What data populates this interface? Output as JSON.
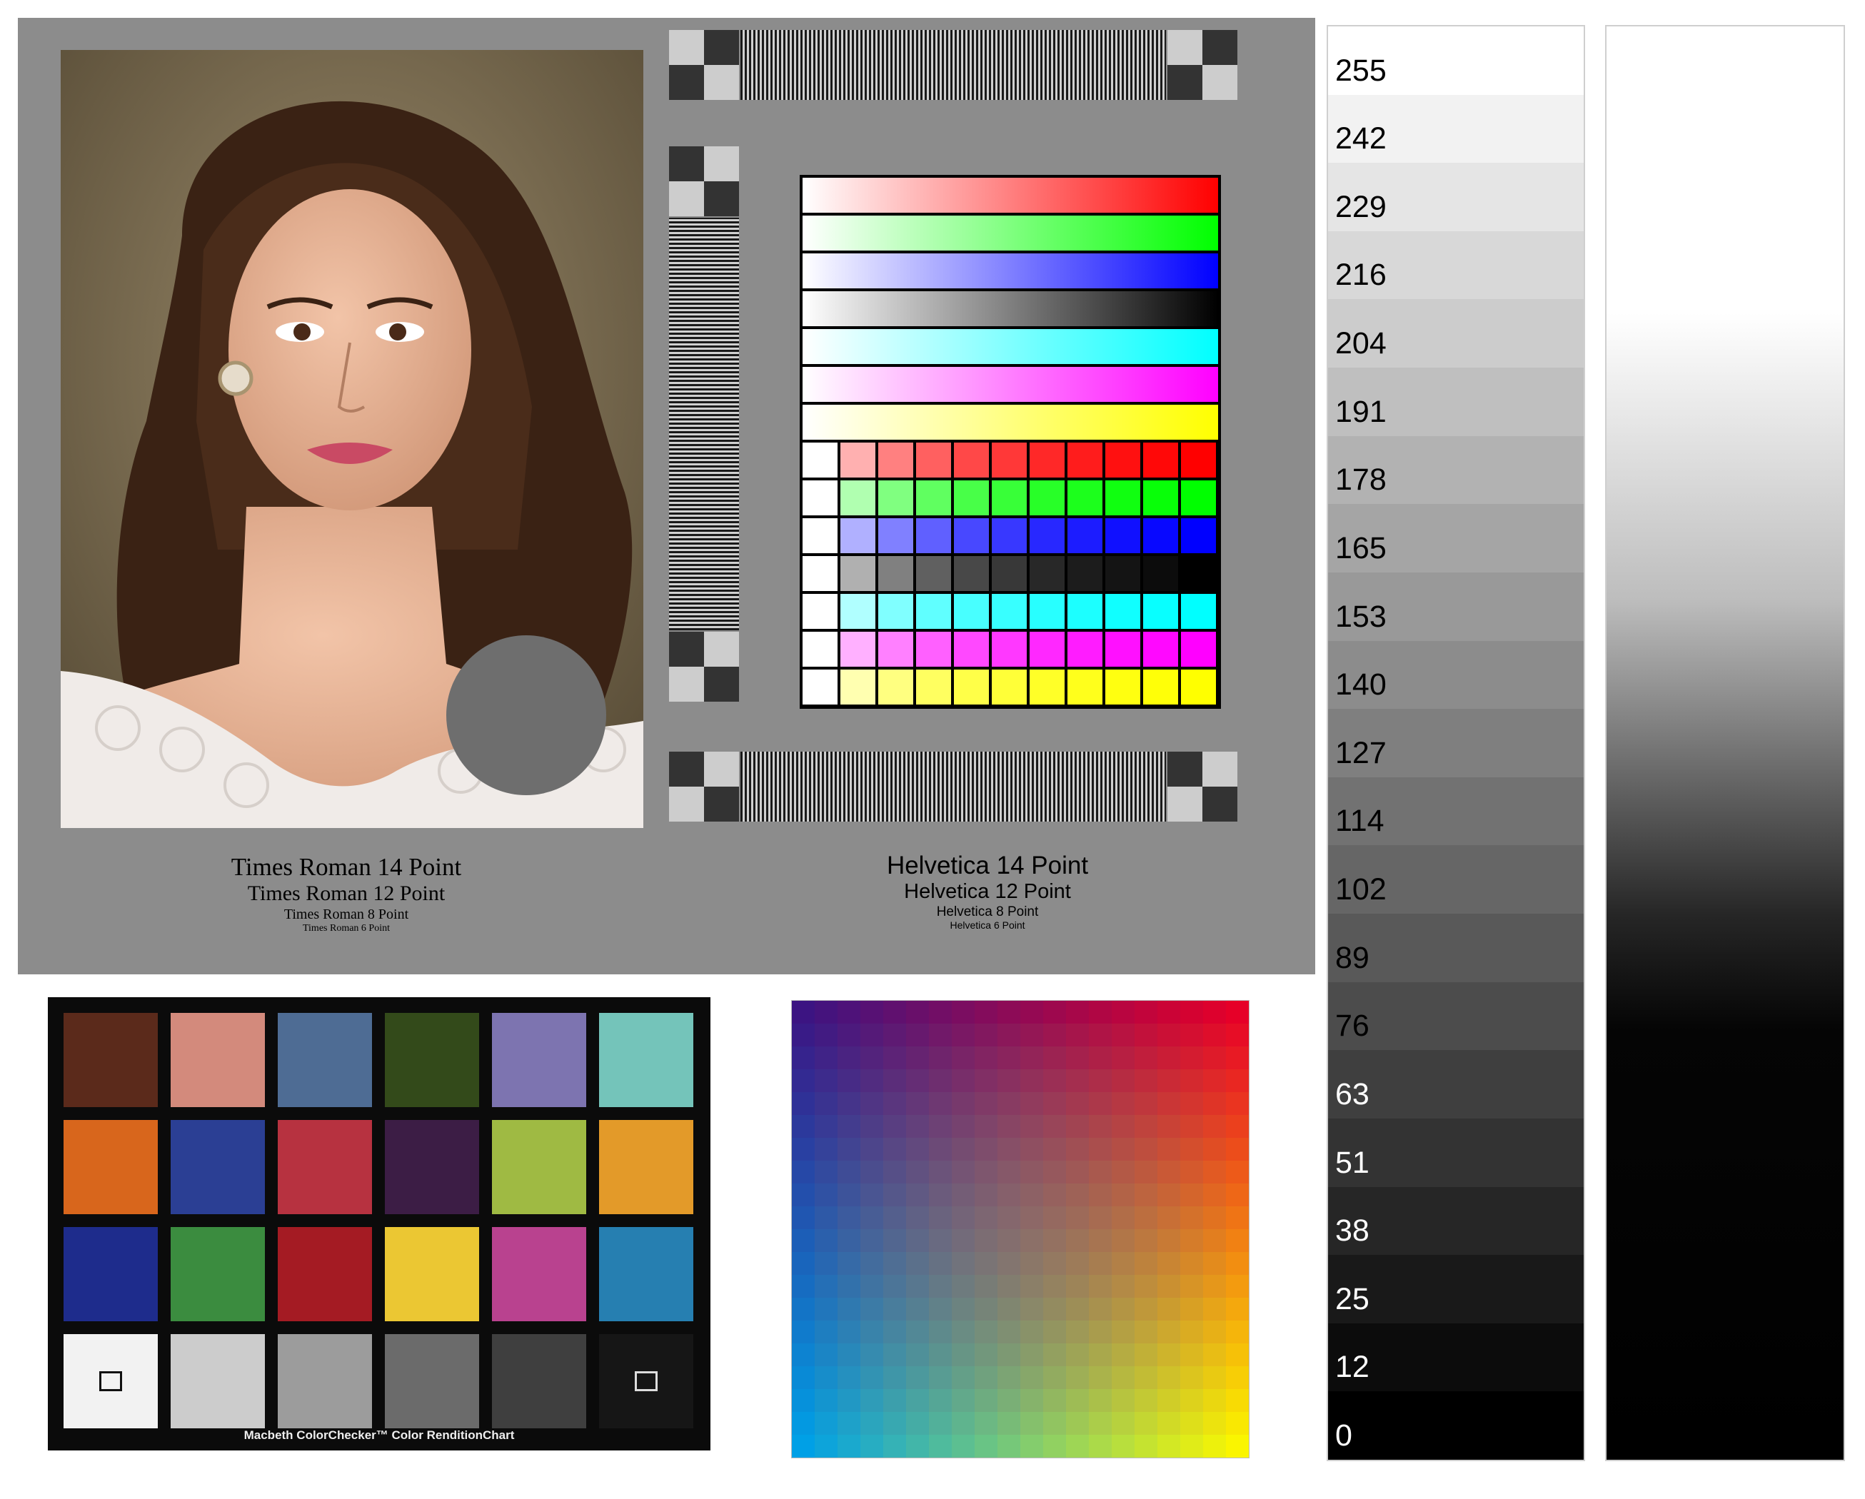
{
  "font_samples": {
    "serif": [
      "Times Roman 14 Point",
      "Times Roman 12 Point",
      "Times Roman 8 Point",
      "Times Roman 6 Point"
    ],
    "sans": [
      "Helvetica 14 Point",
      "Helvetica 12 Point",
      "Helvetica 8 Point",
      "Helvetica 6 Point"
    ]
  },
  "ramps": [
    {
      "name": "red-ramp",
      "color": "#ff0000"
    },
    {
      "name": "green-ramp",
      "color": "#00ff00"
    },
    {
      "name": "blue-ramp",
      "color": "#0000ff"
    },
    {
      "name": "black-ramp",
      "color": "#000000"
    },
    {
      "name": "cyan-ramp",
      "color": "#00ffff"
    },
    {
      "name": "magenta-ramp",
      "color": "#ff00ff"
    },
    {
      "name": "yellow-ramp",
      "color": "#ffff00"
    }
  ],
  "patch_rows": [
    [
      "#ffffff",
      "#ffb0b0",
      "#ff8080",
      "#ff6060",
      "#ff4848",
      "#ff3838",
      "#ff2828",
      "#ff1c1c",
      "#ff1010",
      "#ff0808",
      "#ff0000"
    ],
    [
      "#ffffff",
      "#b0ffb0",
      "#80ff80",
      "#60ff60",
      "#48ff48",
      "#38ff38",
      "#28ff28",
      "#1cff1c",
      "#10ff10",
      "#08ff08",
      "#00ff00"
    ],
    [
      "#ffffff",
      "#b0b0ff",
      "#8080ff",
      "#6060ff",
      "#4848ff",
      "#3838ff",
      "#2828ff",
      "#1c1cff",
      "#1010ff",
      "#0808ff",
      "#0000ff"
    ],
    [
      "#ffffff",
      "#b0b0b0",
      "#808080",
      "#606060",
      "#484848",
      "#383838",
      "#282828",
      "#1c1c1c",
      "#141414",
      "#0c0c0c",
      "#000000"
    ],
    [
      "#ffffff",
      "#b0ffff",
      "#80ffff",
      "#60ffff",
      "#48ffff",
      "#38ffff",
      "#28ffff",
      "#1cffff",
      "#10ffff",
      "#08ffff",
      "#00ffff"
    ],
    [
      "#ffffff",
      "#ffb0ff",
      "#ff80ff",
      "#ff60ff",
      "#ff48ff",
      "#ff38ff",
      "#ff28ff",
      "#ff1cff",
      "#ff10ff",
      "#ff08ff",
      "#ff00ff"
    ],
    [
      "#ffffff",
      "#ffffb0",
      "#ffff80",
      "#ffff60",
      "#ffff48",
      "#ffff38",
      "#ffff28",
      "#ffff1c",
      "#ffff10",
      "#ffff08",
      "#ffff00"
    ]
  ],
  "macbeth": {
    "caption": "Macbeth ColorChecker™ Color RenditionChart",
    "rows": [
      [
        "#5b2a1b",
        "#d38a7c",
        "#4e6c94",
        "#334a1a",
        "#7d74b0",
        "#74c4ba"
      ],
      [
        "#d8661c",
        "#2b3f94",
        "#b73240",
        "#3c1d45",
        "#9fba43",
        "#e39a29"
      ],
      [
        "#1e2c8c",
        "#3b8c3f",
        "#a41b23",
        "#ebc733",
        "#b9428f",
        "#267fb1"
      ],
      [
        "#f2f2f2",
        "#cccccc",
        "#9c9c9c",
        "#6b6b6b",
        "#3f3f3f",
        "#161616"
      ]
    ]
  },
  "gray_steps": [
    "255",
    "242",
    "229",
    "216",
    "204",
    "191",
    "178",
    "165",
    "153",
    "140",
    "127",
    "114",
    "102",
    "89",
    "76",
    "63",
    "51",
    "38",
    "25",
    "12",
    "0"
  ]
}
